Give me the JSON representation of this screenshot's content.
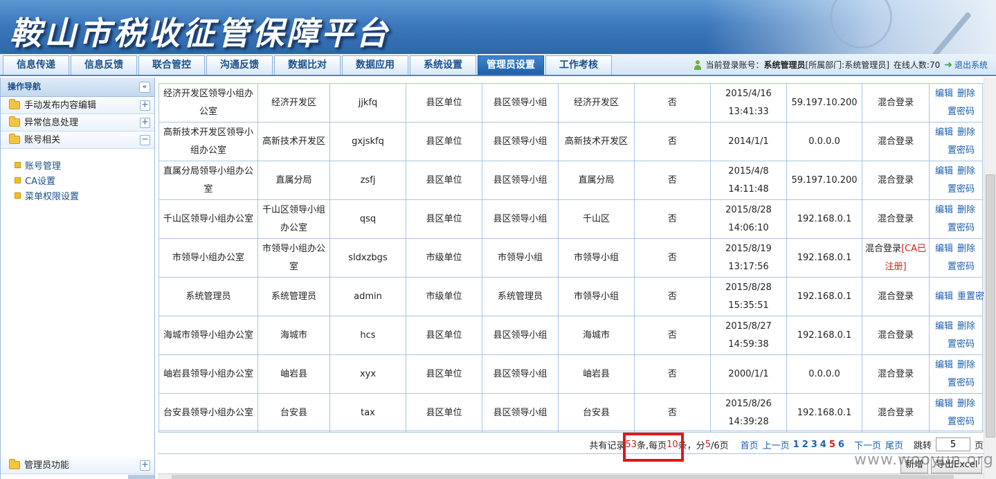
{
  "header": {
    "title": "鞍山市税收征管保障平台"
  },
  "nav": {
    "tabs": [
      {
        "label": "信息传递",
        "active": false
      },
      {
        "label": "信息反馈",
        "active": false
      },
      {
        "label": "联合管控",
        "active": false
      },
      {
        "label": "沟通反馈",
        "active": false
      },
      {
        "label": "数据比对",
        "active": false
      },
      {
        "label": "数据应用",
        "active": false
      },
      {
        "label": "系统设置",
        "active": false
      },
      {
        "label": "管理员设置",
        "active": true
      },
      {
        "label": "工作考核",
        "active": false
      }
    ],
    "user_prefix": "当前登录账号：",
    "user_name": "系统管理员",
    "user_dept": "[所属部门:系统管理员]",
    "online": "在线人数:70",
    "logout": "退出系统"
  },
  "sidebar": {
    "title": "操作导航",
    "collapse_symbol": "«",
    "groups": [
      {
        "label": "手动发布内容编辑",
        "toggle": "+"
      },
      {
        "label": "异常信息处理",
        "toggle": "+"
      },
      {
        "label": "账号相关",
        "toggle": "−"
      }
    ],
    "items": [
      "账号管理",
      "CA设置",
      "菜单权限设置"
    ],
    "bottom_group": {
      "label": "管理员功能",
      "toggle": "+"
    }
  },
  "table": {
    "rows": [
      {
        "name": "经济开发区领导小组办公室",
        "dept": "经济开发区",
        "account": "jjkfq",
        "level": "县区单位",
        "group": "县区领导小组",
        "area": "经济开发区",
        "flag": "否",
        "date": "2015/4/16",
        "time": "13:41:33",
        "ip": "59.197.10.200",
        "login": "混合登录",
        "login_extra": "",
        "ops": [
          "编辑",
          "删除"
        ],
        "ops2": "置密码"
      },
      {
        "name": "高新技术开发区领导小组办公室",
        "dept": "高新技术开发区",
        "account": "gxjskfq",
        "level": "县区单位",
        "group": "县区领导小组",
        "area": "高新技术开发区",
        "flag": "否",
        "date": "2014/1/1",
        "time": "",
        "ip": "0.0.0.0",
        "login": "混合登录",
        "login_extra": "",
        "ops": [
          "编辑",
          "删除"
        ],
        "ops2": "置密码"
      },
      {
        "name": "直属分局领导小组办公室",
        "dept": "直属分局",
        "account": "zsfj",
        "level": "县区单位",
        "group": "县区领导小组",
        "area": "直属分局",
        "flag": "否",
        "date": "2015/4/8",
        "time": "14:11:48",
        "ip": "59.197.10.200",
        "login": "混合登录",
        "login_extra": "",
        "ops": [
          "编辑",
          "删除"
        ],
        "ops2": "置密码"
      },
      {
        "name": "千山区领导小组办公室",
        "dept": "千山区领导小组办公室",
        "account": "qsq",
        "level": "县区单位",
        "group": "县区领导小组",
        "area": "千山区",
        "flag": "否",
        "date": "2015/8/28",
        "time": "14:06:10",
        "ip": "192.168.0.1",
        "login": "混合登录",
        "login_extra": "",
        "ops": [
          "编辑",
          "删除"
        ],
        "ops2": "置密码"
      },
      {
        "name": "市领导小组办公室",
        "dept": "市领导小组办公室",
        "account": "sldxzbgs",
        "level": "市级单位",
        "group": "市领导小组",
        "area": "市领导小组",
        "flag": "否",
        "date": "2015/8/19",
        "time": "13:17:56",
        "ip": "192.168.0.1",
        "login": "混合登录",
        "login_extra": "[CA已注册]",
        "ops": [
          "编辑",
          "删除"
        ],
        "ops2": "置密码"
      },
      {
        "name": "系统管理员",
        "dept": "系统管理员",
        "account": "admin",
        "level": "市级单位",
        "group": "系统管理员",
        "area": "市领导小组",
        "flag": "否",
        "date": "2015/8/28",
        "time": "15:35:51",
        "ip": "192.168.0.1",
        "login": "混合登录",
        "login_extra": "",
        "ops": [
          "编辑",
          "重置密"
        ],
        "ops2": ""
      },
      {
        "name": "海城市领导小组办公室",
        "dept": "海城市",
        "account": "hcs",
        "level": "县区单位",
        "group": "县区领导小组",
        "area": "海城市",
        "flag": "否",
        "date": "2015/8/27",
        "time": "14:59:38",
        "ip": "192.168.0.1",
        "login": "混合登录",
        "login_extra": "",
        "ops": [
          "编辑",
          "删除"
        ],
        "ops2": "置密码"
      },
      {
        "name": "岫岩县领导小组办公室",
        "dept": "岫岩县",
        "account": "xyx",
        "level": "县区单位",
        "group": "县区领导小组",
        "area": "岫岩县",
        "flag": "否",
        "date": "2000/1/1",
        "time": "",
        "ip": "0.0.0.0",
        "login": "混合登录",
        "login_extra": "",
        "ops": [
          "编辑",
          "删除"
        ],
        "ops2": "置密码"
      },
      {
        "name": "台安县领导小组办公室",
        "dept": "台安县",
        "account": "tax",
        "level": "县区单位",
        "group": "县区领导小组",
        "area": "台安县",
        "flag": "否",
        "date": "2015/8/26",
        "time": "14:39:28",
        "ip": "192.168.0.1",
        "login": "混合登录",
        "login_extra": "",
        "ops": [
          "编辑",
          "删除"
        ],
        "ops2": "置密码"
      }
    ]
  },
  "pager": {
    "text_a": "共有记录",
    "total": "53",
    "text_b": "条,每页",
    "per_page": "10",
    "text_c": "条，分",
    "current": "5",
    "text_d": "/6页",
    "first": "首页",
    "prev": "上一页",
    "pages": [
      "1",
      "2",
      "3",
      "4",
      "5",
      "6"
    ],
    "current_page": "5",
    "next": "下一页",
    "last": "尾页",
    "jump_label": "跳转",
    "jump_value": "5",
    "jump_suffix": "页"
  },
  "buttons": {
    "add": "新增",
    "export": "导出Excel"
  },
  "watermark": "www.wooyun.org",
  "colors": {
    "accent": "#1f5fa6",
    "highlight": "#e21717",
    "link": "#1b5fae"
  }
}
